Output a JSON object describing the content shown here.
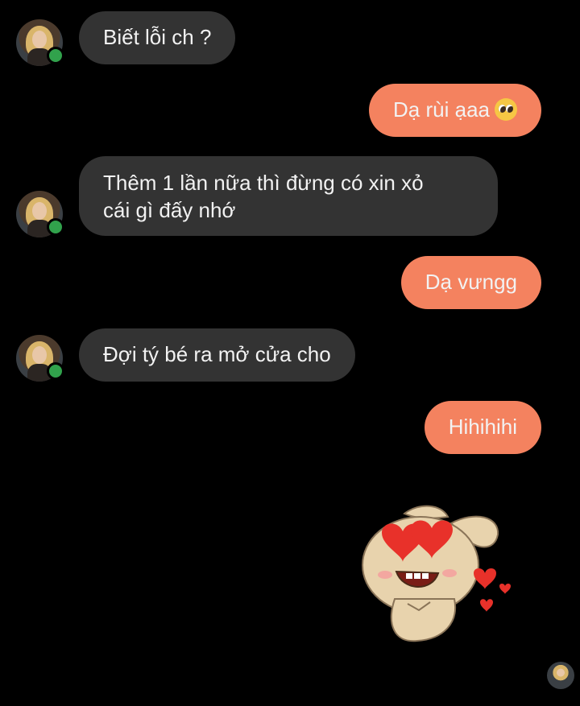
{
  "conversation": {
    "messages": [
      {
        "side": "in",
        "text": "Biết lỗi ch ?"
      },
      {
        "side": "out",
        "text": "Dạ rùi ạaa",
        "emoji": "pleading-face-emoji"
      },
      {
        "side": "in",
        "lines": [
          "Thêm 1 lần nữa thì đừng có xin xỏ",
          "cái gì đấy nhớ"
        ]
      },
      {
        "side": "out",
        "text": "Dạ vưngg"
      },
      {
        "side": "in",
        "text": "Đợi tý bé ra mở cửa cho"
      },
      {
        "side": "out",
        "text": "Hihihihi"
      }
    ],
    "sticker": "puppy-heart-eyes-sticker"
  },
  "colors": {
    "background": "#000000",
    "incoming_bubble": "#333333",
    "outgoing_bubble": "#f4825f",
    "online_dot": "#31a24c"
  }
}
